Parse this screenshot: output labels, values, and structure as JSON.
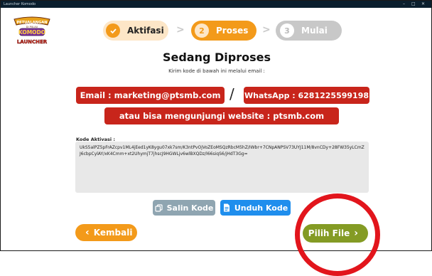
{
  "window": {
    "title": "Launcher Komodo",
    "controls": {
      "minimize": "–",
      "maximize": "□",
      "close": "✕"
    }
  },
  "logo": {
    "line1": "PETUALANGAN",
    "line2": "DI PULAU",
    "line3": "KOMODO",
    "line4": "LAUNCHER"
  },
  "steps": [
    {
      "number": "✓",
      "label": "Aktifasi",
      "state": "done"
    },
    {
      "number": "2",
      "label": "Proses",
      "state": "active"
    },
    {
      "number": "3",
      "label": "Mulai",
      "state": "pending"
    }
  ],
  "step_separator": ">",
  "heading": "Sedang Diproses",
  "subheading": "Kirim kode di bawah ini melalui email :",
  "contact": {
    "email": "Email : marketing@ptsmb.com",
    "separator": "/",
    "whatsapp": "WhatsApp : 6281225599198",
    "website": "atau bisa mengunjungi website : ptsmb.com"
  },
  "activation": {
    "label": "Kode Aktivasi :",
    "code": "UkS5alPZ5pFrAZcpv1ML4jEed1yK8ygu07xk7sm/K3ntPvOjVoZEoMSQzRbcM5hZ/IWbr+7CNpANPSV73UYJ11M/8vnCDy+28FW35yLCmZJ6cbpCylAY/xK4Cmm+xt2UhymjT7jhscJ9HGWLjv6wlBXQDz/l66siqS6/jHdT3Gg="
  },
  "buttons": {
    "copy": "Salin Kode",
    "download": "Unduh Kode",
    "back": "Kembali",
    "back_icon": "‹",
    "next": "Pilih File",
    "next_icon": "›"
  },
  "colors": {
    "accent_orange": "#f39a1a",
    "brand_red": "#c8251b",
    "next_green": "#849b24",
    "download_blue": "#1f8eed",
    "copy_gray": "#8fa5b1",
    "annotation_red": "#e2151c"
  }
}
